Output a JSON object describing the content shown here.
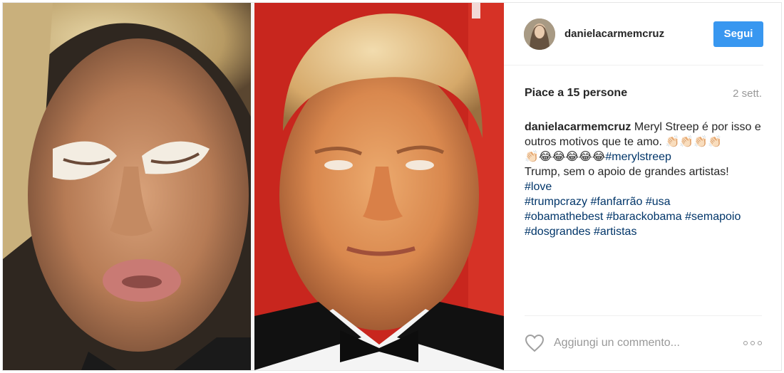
{
  "post": {
    "username": "danielacarmemcruz",
    "follow_label": "Segui",
    "likes_text": "Piace a 15 persone",
    "time_text": "2 sett.",
    "caption": {
      "username": "danielacarmemcruz",
      "text_1": "Meryl Streep é por isso e outros motivos que te amo.",
      "emoji_clap_1": "👏🏻👏🏻👏🏻👏🏻",
      "emoji_clap_2": "👏🏻",
      "emoji_laugh": "😂😂😂😂😂",
      "tag_1": "#merylstreep",
      "text_2": "Trump, sem o apoio de grandes artistas!",
      "tags_line_1": [
        "#love"
      ],
      "tags_line_2": [
        "#trumpcrazy",
        "#fanfarrão",
        "#usa"
      ],
      "tags_line_3": [
        "#obamathebest",
        "#barackobama",
        "#semapoio"
      ],
      "tags_line_4": [
        "#dosgrandes",
        "#artistas"
      ]
    },
    "comment_placeholder": "Aggiungi un commento...",
    "icons": {
      "like": "heart-outline-icon",
      "more": "more-options-icon"
    },
    "colors": {
      "follow_button": "#3897f0",
      "hashtag": "#003569",
      "muted": "#999999"
    }
  }
}
